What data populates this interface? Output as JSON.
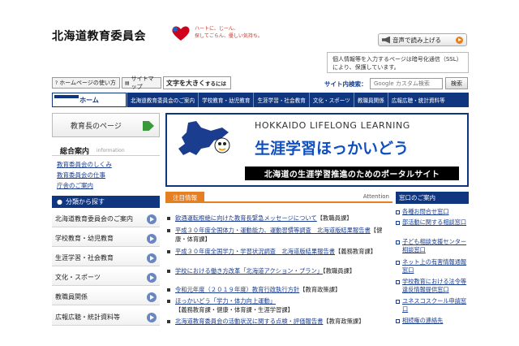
{
  "header": {
    "site_title": "北海道教育委員会",
    "tagline": [
      "ハートに、じーん、",
      "探してごらん、優しい気持ち。"
    ],
    "read_aloud": "音声で読み上げる",
    "notice": "個人情報等を入力するページは暗号化通信（SSL）により、保護しています。"
  },
  "utility": {
    "howto": "ホームページの使い方",
    "sitemap": "サイトマップ",
    "bigtext_main": "文字を大きく",
    "bigtext_sub": "するには",
    "search_label": "サイト内検索：",
    "search_placeholder": "Google カスタム検索",
    "search_button": "検索"
  },
  "nav": {
    "home": "ホーム",
    "items": [
      "北海道教育委員会のご案内",
      "学校教育・幼児教育",
      "生涯学習・社会教育",
      "文化・スポーツ",
      "教職員関係",
      "広報広聴・統計資料等"
    ]
  },
  "sidebar": {
    "chief": "教育長のページ",
    "general_title": "総合案内",
    "general_en": "information",
    "general_links": [
      "教育委員会のしくみ",
      "教育委員会の仕事",
      "庁舎のご案内"
    ],
    "category_title": "分類から探す",
    "categories": [
      "北海道教育委員会のご案内",
      "学校教育・幼児教育",
      "生涯学習・社会教育",
      "文化・スポーツ",
      "教職員関係",
      "広報広聴・統計資料等"
    ]
  },
  "banner": {
    "en": "HOKKAIDO LIFELONG LEARNING",
    "jp": "生涯学習ほっかいどう",
    "sub": "北海道の生涯学習推進のためのポータルサイト"
  },
  "notices": {
    "title": "注目情報",
    "en": "Attention",
    "items": [
      {
        "link": "飲酒運転根絶に向けた教育長緊急メッセージについて",
        "tag": "【教職員課】"
      },
      {
        "link": "平成３０年度全国体力・運動能力、運動習慣等調査　北海道版結果報告書",
        "tag": "【健康・体育課】"
      },
      {
        "link": "平成３０年度全国学力・学習状況調査　北海道版結果報告書",
        "tag": "【義務教育課】"
      },
      {
        "link": "学校における働き方改革「北海道アクション・プラン」",
        "tag": "【教職員課】"
      },
      {
        "link": "令和元年度（２０１９年度）教育行政執行方針",
        "tag": "【教育政策課】"
      },
      {
        "link": "ほっかいどう「学力・体力向上運動」",
        "tag": "【義務教育課・健康・体育課・生涯学習課】"
      },
      {
        "link": "北海道教育委員会の活動状況に関する点検・評価報告書",
        "tag": "【教育政策課】"
      }
    ]
  },
  "contact": {
    "title": "窓口のご案内",
    "items": [
      "各種お問合せ窓口",
      "部活動に関する相談窓口",
      "子ども相談支援センター相談窓口",
      "ネット上の有害情報通報窓口",
      "学校教育における法令等違反情報提供窓口",
      "ユネスコスクール申請窓口",
      "相続権の連絡先"
    ]
  },
  "colors": {
    "navy": "#10367f",
    "accent": "#e67e22",
    "link": "#1a3d8f"
  }
}
